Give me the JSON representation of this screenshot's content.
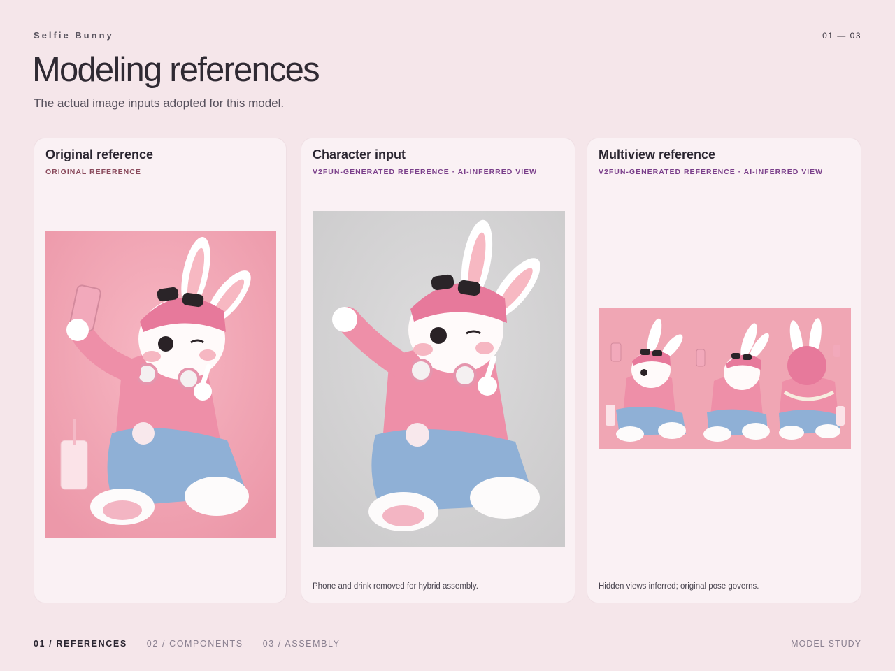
{
  "header": {
    "eyebrow": "Selfie Bunny",
    "page_count": "01 — 03",
    "title": "Modeling references",
    "subtitle": "The actual image inputs adopted for this model."
  },
  "cards": [
    {
      "title": "Original reference",
      "tag": "ORIGINAL REFERENCE",
      "note": ""
    },
    {
      "title": "Character input",
      "tag": "V2FUN-GENERATED REFERENCE · AI-INFERRED VIEW",
      "note": "Phone and drink removed for hybrid assembly."
    },
    {
      "title": "Multiview reference",
      "tag": "V2FUN-GENERATED REFERENCE · AI-INFERRED VIEW",
      "note": "Hidden views inferred; original pose governs."
    }
  ],
  "footer": {
    "nav": [
      {
        "label": "01 / REFERENCES",
        "active": true
      },
      {
        "label": "02 / COMPONENTS",
        "active": false
      },
      {
        "label": "03 / ASSEMBLY",
        "active": false
      }
    ],
    "right": "MODEL STUDY"
  },
  "colors": {
    "background": "#f5e6ea",
    "card": "#faf1f4",
    "tag_original": "#8a4a5c",
    "tag_generated": "#7a3f8a",
    "photo_pink": "#f2a4b4",
    "photo_gray": "#d4d3d4"
  }
}
